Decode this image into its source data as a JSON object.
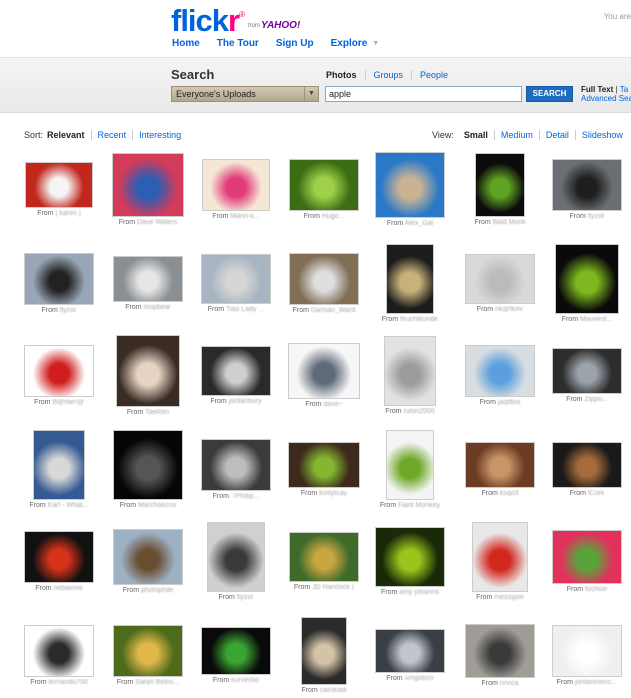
{
  "header": {
    "logo": {
      "part1": "flick",
      "part2": "r",
      "reg": "®",
      "from": "from",
      "yahoo": "YAHOO!"
    },
    "you_are": "You are",
    "nav": [
      {
        "label": "Home"
      },
      {
        "label": "The Tour"
      },
      {
        "label": "Sign Up"
      },
      {
        "label": "Explore",
        "has_menu": true
      }
    ]
  },
  "search": {
    "title": "Search",
    "types": [
      "Photos",
      "Groups",
      "People"
    ],
    "scope_value": "Everyone's Uploads",
    "query_value": "apple",
    "button_label": "SEARCH",
    "fulltext_label": "Full Text",
    "fulltext_sep": "|",
    "tags_label": "Ta",
    "advanced_label": "Advanced Sea"
  },
  "sort": {
    "label": "Sort:",
    "options": [
      "Relevant",
      "Recent",
      "Interesting"
    ],
    "selected": 0
  },
  "view": {
    "label": "View:",
    "options": [
      "Small",
      "Medium",
      "Detail",
      "Slideshow"
    ],
    "selected": 0
  },
  "thumbnails": [
    {
      "from": "From",
      "src": "[ karen ]",
      "colors": [
        "#c1271c",
        "#f4f4f4"
      ]
    },
    {
      "from": "From",
      "src": "Dave Waters",
      "colors": [
        "#d23b5a",
        "#2e5db4"
      ]
    },
    {
      "from": "From",
      "src": "Mann-k...",
      "colors": [
        "#f5e7d6",
        "#e03b7a"
      ]
    },
    {
      "from": "From",
      "src": "Hugo...",
      "colors": [
        "#3c6d14",
        "#9ed04a"
      ]
    },
    {
      "from": "From",
      "src": "Alex_Gal",
      "colors": [
        "#2a78c7",
        "#c9b394"
      ]
    },
    {
      "from": "From",
      "src": "Bald Monk",
      "colors": [
        "#0b0b0b",
        "#5fa322"
      ]
    },
    {
      "from": "From",
      "src": "flyzor",
      "colors": [
        "#6b6f74",
        "#1e1e1e"
      ]
    },
    {
      "from": "From",
      "src": "flyzor",
      "colors": [
        "#98a6b5",
        "#222"
      ]
    },
    {
      "from": "From",
      "src": "loopbear",
      "colors": [
        "#8a8f94",
        "#e6e6e6"
      ]
    },
    {
      "from": "From",
      "src": "Tiao Lady ...",
      "colors": [
        "#a8b4c2",
        "#d6d6d6"
      ]
    },
    {
      "from": "From",
      "src": "Damian_Ward",
      "colors": [
        "#806f55",
        "#dedede"
      ]
    },
    {
      "from": "From",
      "src": "feuchtkunde",
      "colors": [
        "#1d1d1d",
        "#c7b27a"
      ]
    },
    {
      "from": "From",
      "src": "nk@fkmr",
      "colors": [
        "#d9d9d9",
        "#bbb"
      ]
    },
    {
      "from": "From",
      "src": "Mauvest...",
      "colors": [
        "#0a0a0a",
        "#7eb81e"
      ]
    },
    {
      "from": "From",
      "src": "B@rber@",
      "colors": [
        "#ffffff",
        "#d01d1d"
      ]
    },
    {
      "from": "From",
      "src": "TaeRen",
      "colors": [
        "#3a2b25",
        "#e6d3c3"
      ]
    },
    {
      "from": "From",
      "src": "jordanbury",
      "colors": [
        "#2a2a2a",
        "#cfcfcf"
      ]
    },
    {
      "from": "From",
      "src": "dave~",
      "colors": [
        "#f7f7f7",
        "#5e6a78"
      ]
    },
    {
      "from": "From",
      "src": "rulon2000",
      "colors": [
        "#e2e2e2",
        "#9c9c9c"
      ]
    },
    {
      "from": "From",
      "src": "jaqdtos",
      "colors": [
        "#d8dde1",
        "#5aa0de"
      ]
    },
    {
      "from": "From",
      "src": "Zippo...",
      "colors": [
        "#2d2d2d",
        "#9ba3aa"
      ]
    },
    {
      "from": "From",
      "src": "Earl - What...",
      "colors": [
        "#355a92",
        "#d8d8d8"
      ]
    },
    {
      "from": "From",
      "src": "Marchsezno",
      "colors": [
        "#050505",
        "#555"
      ]
    },
    {
      "from": "From",
      "src": "::Phillip...",
      "colors": [
        "#3b3b3b",
        "#bdbdbd"
      ]
    },
    {
      "from": "From",
      "src": "kivilytcay",
      "colors": [
        "#3d2a1c",
        "#84b630"
      ]
    },
    {
      "from": "From",
      "src": "Faint Monkey",
      "colors": [
        "#f4f4f4",
        "#6ea828"
      ]
    },
    {
      "from": "From",
      "src": "ksqo3",
      "colors": [
        "#6b3b24",
        "#c99466"
      ]
    },
    {
      "from": "From",
      "src": "lCork",
      "colors": [
        "#1a1a1a",
        "#a56b3a"
      ]
    },
    {
      "from": "From",
      "src": "nebaeme",
      "colors": [
        "#111111",
        "#d8321b"
      ]
    },
    {
      "from": "From",
      "src": "photophile",
      "colors": [
        "#9db0c4",
        "#6b4d32"
      ]
    },
    {
      "from": "From",
      "src": "flyzor",
      "colors": [
        "#d0d0d0",
        "#3a3a3a"
      ]
    },
    {
      "from": "From",
      "src": "JD Hancock (",
      "colors": [
        "#3e6a2c",
        "#c8a640"
      ]
    },
    {
      "from": "From",
      "src": "amy johanns",
      "colors": [
        "#1a2a08",
        "#9ac41c"
      ]
    },
    {
      "from": "From",
      "src": "messyjoe",
      "colors": [
        "#e8e8e8",
        "#d2281e"
      ]
    },
    {
      "from": "From",
      "src": "fochsie",
      "colors": [
        "#e3315b",
        "#5aa23c"
      ]
    },
    {
      "from": "From",
      "src": "fernando750",
      "colors": [
        "#ffffff",
        "#2a2a2a"
      ]
    },
    {
      "from": "From",
      "src": "Sarah Belos...",
      "colors": [
        "#4d6b1a",
        "#e0b84a"
      ]
    },
    {
      "from": "From",
      "src": "kurvestio",
      "colors": [
        "#0a0a0a",
        "#3aa632"
      ]
    },
    {
      "from": "From",
      "src": "calcikadi",
      "colors": [
        "#2a2a2a",
        "#d5c3a8"
      ]
    },
    {
      "from": "From",
      "src": "umgidoro",
      "colors": [
        "#3a3f46",
        "#c2c6cc"
      ]
    },
    {
      "from": "From",
      "src": "nrvica",
      "colors": [
        "#a09c96",
        "#3a3a3a"
      ]
    },
    {
      "from": "From",
      "src": "jordanmeric...",
      "colors": [
        "#efefef",
        "#ffffff"
      ]
    }
  ]
}
